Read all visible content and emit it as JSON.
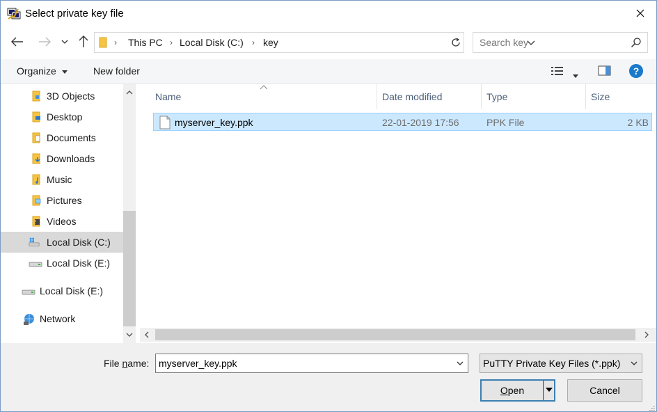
{
  "window": {
    "title": "Select private key file"
  },
  "address": {
    "crumbs": [
      "This PC",
      "Local Disk (C:)",
      "key"
    ]
  },
  "search": {
    "placeholder": "Search key"
  },
  "toolbar": {
    "organize": "Organize",
    "new_folder": "New folder"
  },
  "sidebar": {
    "items": [
      {
        "label": "3D Objects",
        "icon": "3d-objects-folder-icon"
      },
      {
        "label": "Desktop",
        "icon": "desktop-folder-icon"
      },
      {
        "label": "Documents",
        "icon": "documents-folder-icon"
      },
      {
        "label": "Downloads",
        "icon": "downloads-folder-icon"
      },
      {
        "label": "Music",
        "icon": "music-folder-icon"
      },
      {
        "label": "Pictures",
        "icon": "pictures-folder-icon"
      },
      {
        "label": "Videos",
        "icon": "videos-folder-icon"
      },
      {
        "label": "Local Disk (C:)",
        "icon": "system-drive-icon",
        "selected": true
      },
      {
        "label": "Local Disk (E:)",
        "icon": "drive-icon"
      },
      {
        "label": "Local Disk (E:)",
        "icon": "drive-icon"
      },
      {
        "label": "Network",
        "icon": "network-icon"
      }
    ]
  },
  "columns": {
    "name": "Name",
    "date": "Date modified",
    "type": "Type",
    "size": "Size"
  },
  "files": [
    {
      "name": "myserver_key.ppk",
      "date": "22-01-2019 17:56",
      "type": "PPK File",
      "size": "2 KB",
      "selected": true
    }
  ],
  "footer": {
    "filename_label": "File name:",
    "filename_value": "myserver_key.ppk",
    "filetype": "PuTTY Private Key Files (*.ppk)",
    "open_label": "Open",
    "cancel_label": "Cancel"
  },
  "colors": {
    "selection": "#cce8ff",
    "selection_border": "#99d1ff",
    "help": "#1979ca",
    "folder": "#f6c343"
  }
}
